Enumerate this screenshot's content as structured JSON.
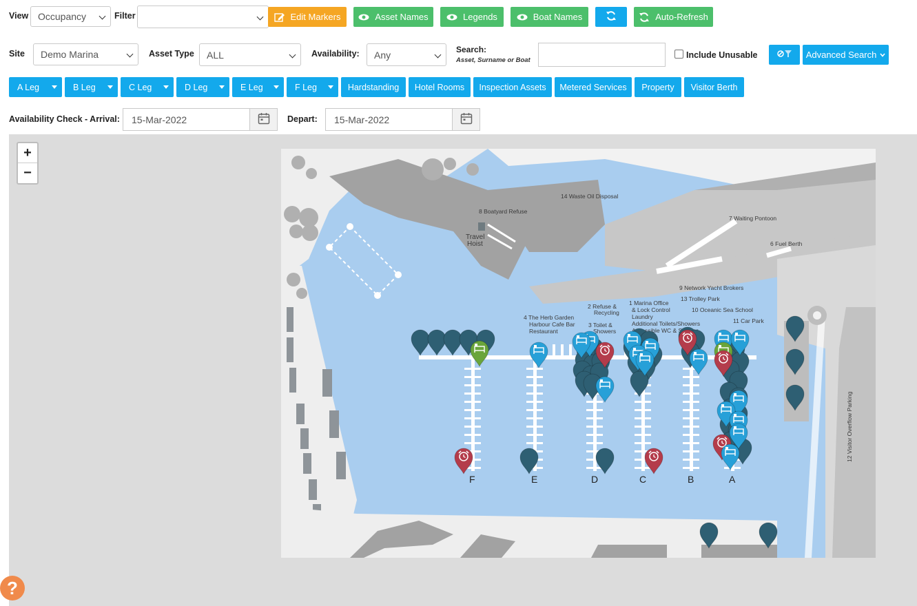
{
  "toolbar": {
    "view_label": "View",
    "view_value": "Occupancy",
    "filter_label": "Filter",
    "filter_value": "",
    "edit_markers": "Edit Markers",
    "asset_names": "Asset Names",
    "legends": "Legends",
    "boat_names": "Boat Names",
    "auto_refresh": "Auto-Refresh"
  },
  "filters": {
    "site_label": "Site",
    "site_value": "Demo Marina",
    "asset_type_label": "Asset Type",
    "asset_type_value": "ALL",
    "availability_label": "Availability:",
    "availability_value": "Any",
    "search_label": "Search:",
    "search_hint": "Asset, Surname or Boat",
    "search_value": "",
    "include_unusable": "Include Unusable",
    "advanced_search": "Advanced Search"
  },
  "legs": [
    {
      "label": "A Leg"
    },
    {
      "label": "B Leg"
    },
    {
      "label": "C Leg"
    },
    {
      "label": "D Leg"
    },
    {
      "label": "E Leg"
    },
    {
      "label": "F Leg"
    }
  ],
  "categories": [
    {
      "label": "Hardstanding"
    },
    {
      "label": "Hotel Rooms"
    },
    {
      "label": "Inspection Assets"
    },
    {
      "label": "Metered Services"
    },
    {
      "label": "Property"
    },
    {
      "label": "Visitor Berth"
    }
  ],
  "availability_check": {
    "arrival_label": "Availability Check - Arrival:",
    "arrival_value": "15-Mar-2022",
    "depart_label": "Depart:",
    "depart_value": "15-Mar-2022"
  },
  "map": {
    "zoom_in": "+",
    "zoom_out": "−",
    "labels": {
      "waste_oil": "14 Waste Oil Disposal",
      "boatyard_refuse": "8 Boatyard Refuse",
      "travel_hoist_1": "Travel",
      "travel_hoist_2": "Hoist",
      "waiting_pontoon": "7 Waiting Pontoon",
      "fuel_berth": "6 Fuel Berth",
      "yacht_brokers": "9 Network Yacht Brokers",
      "trolley_park": "13 Trolley Park",
      "sea_school": "10 Oceanic Sea School",
      "car_park": "11 Car Park",
      "refuse_1": "2 Refuse &",
      "refuse_2": "Recycling",
      "marina_office_1": "1 Marina Office",
      "marina_office_2": "& Lock Control",
      "marina_office_3": "Laundry",
      "marina_office_4": "Additional Toilets/Showers",
      "marina_office_5": "Accessible WC & Shower",
      "herb_garden_1": "4 The Herb Garden",
      "herb_garden_2": "Harbour Cafe Bar",
      "herb_garden_3": "Restaurant",
      "toilets_1": "3 Toilet &",
      "toilets_2": "Showers",
      "overflow_parking": "12 Visitor Overflow Parking"
    },
    "pontoons": [
      "F",
      "E",
      "D",
      "C",
      "B",
      "A"
    ]
  },
  "help_icon": "?",
  "colors": {
    "blue": "#13a9ec",
    "green": "#4cbf6b",
    "orange": "#f5a623",
    "water": "#a9cdef",
    "pin_dark": "#2e5f73",
    "pin_blue": "#27a0d8",
    "pin_red": "#b43c4b",
    "pin_green": "#6aa53a"
  }
}
